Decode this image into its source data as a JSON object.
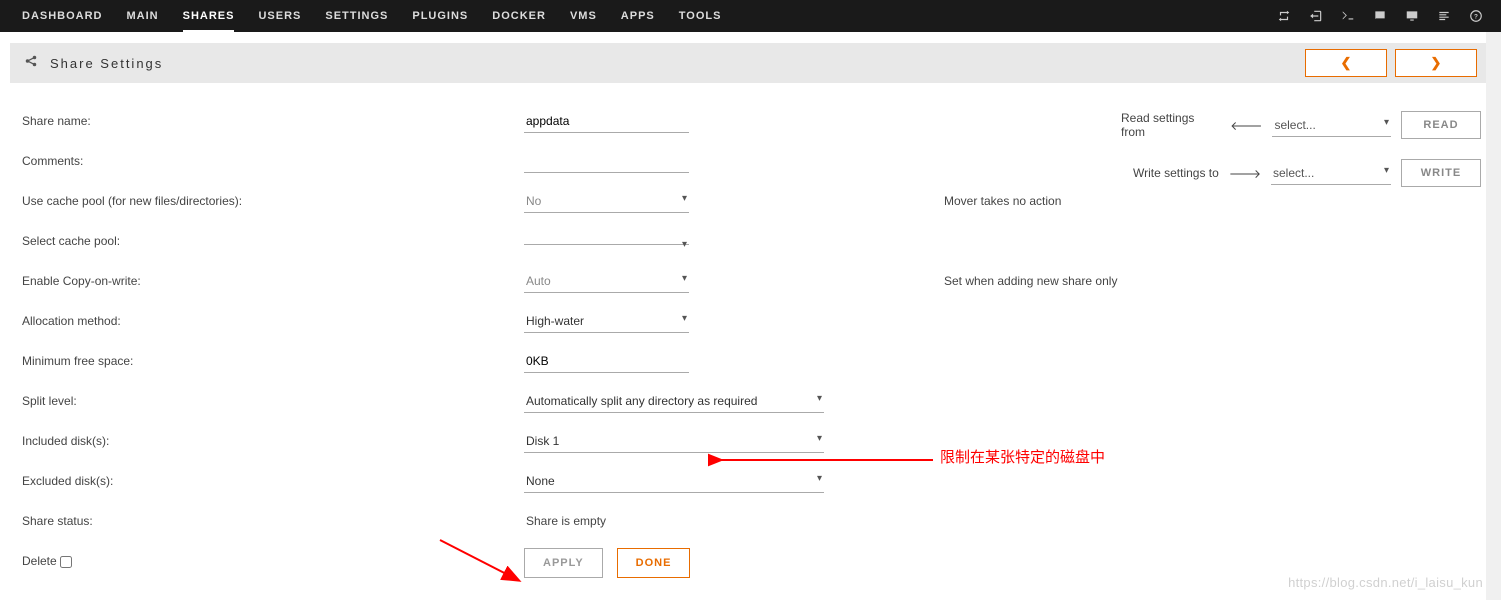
{
  "nav": {
    "items": [
      "DASHBOARD",
      "MAIN",
      "SHARES",
      "USERS",
      "SETTINGS",
      "PLUGINS",
      "DOCKER",
      "VMS",
      "APPS",
      "TOOLS"
    ],
    "active_index": 2
  },
  "titlebar": {
    "title": "Share Settings",
    "prev_glyph": "❮",
    "next_glyph": "❯"
  },
  "side": {
    "read_label": "Read settings from",
    "read_select": "select...",
    "read_btn": "READ",
    "write_label": "Write settings to",
    "write_select": "select...",
    "write_btn": "WRITE"
  },
  "form": {
    "share_name": {
      "label": "Share name:",
      "value": "appdata"
    },
    "comments": {
      "label": "Comments:",
      "value": ""
    },
    "use_cache": {
      "label": "Use cache pool (for new files/directories):",
      "value": "No",
      "aux": "Mover takes no action"
    },
    "select_cache": {
      "label": "Select cache pool:",
      "value": ""
    },
    "cow": {
      "label": "Enable Copy-on-write:",
      "value": "Auto",
      "aux": "Set when adding new share only"
    },
    "alloc": {
      "label": "Allocation method:",
      "value": "High-water"
    },
    "min_free": {
      "label": "Minimum free space:",
      "value": "0KB"
    },
    "split": {
      "label": "Split level:",
      "value": "Automatically split any directory as required"
    },
    "included": {
      "label": "Included disk(s):",
      "value": "Disk 1"
    },
    "excluded": {
      "label": "Excluded disk(s):",
      "value": "None"
    },
    "status": {
      "label": "Share status:",
      "value": "Share is empty"
    },
    "delete": {
      "label": "Delete"
    }
  },
  "buttons": {
    "apply": "APPLY",
    "done": "DONE"
  },
  "annotations": {
    "text1": "限制在某张特定的磁盘中"
  },
  "watermark": "https://blog.csdn.net/i_laisu_kun"
}
